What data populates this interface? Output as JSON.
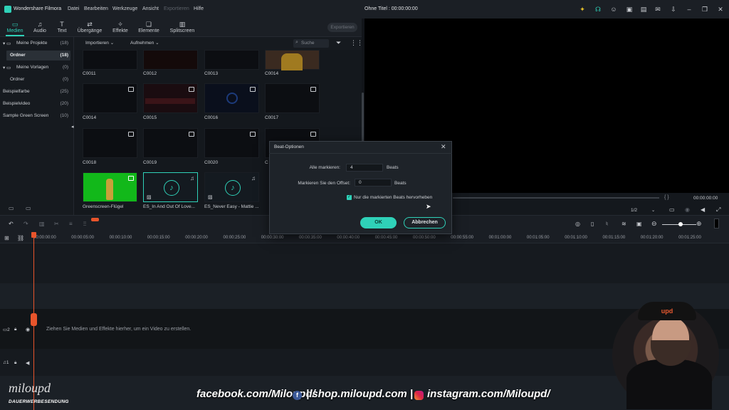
{
  "app": {
    "name": "Wondershare Filmora",
    "menu": [
      "Datei",
      "Bearbeiten",
      "Werkzeuge",
      "Ansicht",
      "Exportieren",
      "Hilfe"
    ],
    "window_title": "Ohne Titel : 00:00:00:00"
  },
  "tabs": [
    {
      "label": "Medien",
      "icon": "folder-icon"
    },
    {
      "label": "Audio",
      "icon": "music-note-icon"
    },
    {
      "label": "Text",
      "icon": "text-icon"
    },
    {
      "label": "Übergänge",
      "icon": "transition-icon"
    },
    {
      "label": "Effekte",
      "icon": "effects-icon"
    },
    {
      "label": "Elemente",
      "icon": "elements-icon"
    },
    {
      "label": "Splitscreen",
      "icon": "splitscreen-icon"
    }
  ],
  "export_label": "Exportieren",
  "left_panel": {
    "rows": [
      {
        "label": "Meine Projekte",
        "count": "(18)"
      },
      {
        "label": "Ordner",
        "count": "(18)"
      },
      {
        "label": "Meine Vorlagen",
        "count": "(0)"
      },
      {
        "label": "Ordner",
        "count": "(0)"
      },
      {
        "label": "Beispielfarbe",
        "count": "(25)"
      },
      {
        "label": "Beispielvideo",
        "count": "(20)"
      },
      {
        "label": "Sample Green Screen",
        "count": "(10)"
      }
    ]
  },
  "media_bar": {
    "import_label": "Importieren",
    "record_label": "Aufnehmen",
    "search_placeholder": "Suche"
  },
  "media_items": [
    {
      "label": "C0011"
    },
    {
      "label": "C0012"
    },
    {
      "label": "C0013"
    },
    {
      "label": "C0014"
    },
    {
      "label": "C0014"
    },
    {
      "label": "C0015"
    },
    {
      "label": "C0016"
    },
    {
      "label": "C0017"
    },
    {
      "label": "C0018"
    },
    {
      "label": "C0019"
    },
    {
      "label": "C0020"
    },
    {
      "label": "C"
    },
    {
      "label": "Greenscreen-Flügel"
    },
    {
      "label": "ES_In And Out Of Love..."
    },
    {
      "label": "ES_Never Easy - Mattie ..."
    }
  ],
  "preview": {
    "timecode": "00:00:00:00",
    "brackets": "{   }",
    "zoom": "1/2"
  },
  "ruler_ticks": [
    "00:00:00:00",
    "00:00:05:00",
    "00:00:10:00",
    "00:00:15:00",
    "00:00:20:00",
    "00:00:25:00",
    "00:00:30:00",
    "00:00:35:00",
    "00:00:40:00",
    "00:00:45:00",
    "00:00:50:00",
    "00:00:55:00",
    "00:01:00:00",
    "00:01:05:00",
    "00:01:10:00",
    "00:01:15:00",
    "00:01:20:00",
    "00:01:25:00"
  ],
  "timeline": {
    "drop_hint": "Ziehen Sie Medien und Effekte hierher, um ein Video zu erstellen.",
    "video_track": "2",
    "audio_track": "1"
  },
  "dialog": {
    "title": "Beat-Optionen",
    "mark_all_label": "Alle markieren:",
    "mark_all_value": "4",
    "mark_all_unit": "Beats",
    "offset_label": "Markieren Sie den Offset:",
    "offset_value": "0",
    "offset_unit": "Beats",
    "checkbox_label": "Nur die markierten Beats hervorheben",
    "checkbox_checked": true,
    "ok_label": "OK",
    "cancel_label": "Abbrechen"
  },
  "overlay": {
    "social": "facebook.com/Miloupd/",
    "shop": "| shop.miloupd.com |",
    "instagram": "instagram.com/Miloupd/",
    "logo": "miloupd",
    "logo_sub": "DAUERWERBESENDUNG",
    "cap_text": "upd"
  },
  "colors": {
    "accent": "#2fd1b8",
    "playhead": "#e8542b"
  }
}
